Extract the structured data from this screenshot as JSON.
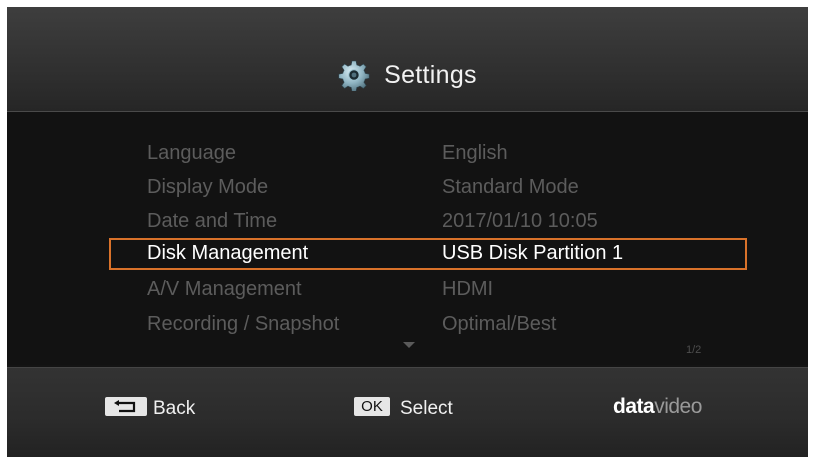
{
  "header": {
    "title": "Settings",
    "icon": "gear-icon"
  },
  "menu": {
    "items": [
      {
        "label": "Language",
        "value": "English"
      },
      {
        "label": "Display Mode",
        "value": "Standard Mode"
      },
      {
        "label": "Date and Time",
        "value": "2017/01/10 10:05"
      },
      {
        "label": "Disk Management",
        "value": "USB Disk Partition 1",
        "selected": true
      },
      {
        "label": "A/V Management",
        "value": "HDMI"
      },
      {
        "label": "Recording / Snapshot",
        "value": "Optimal/Best"
      }
    ],
    "page_indicator": "1/2",
    "scroll_icon": "triangle-down-icon"
  },
  "footer": {
    "back_key_icon": "return-arrow-icon",
    "back_label": "Back",
    "ok_key": "OK",
    "select_label": "Select",
    "brand_part1": "data",
    "brand_part2": "video"
  },
  "colors": {
    "highlight_border": "#d9722a",
    "dim_text": "#5c5c5c",
    "active_text": "#ffffff"
  }
}
